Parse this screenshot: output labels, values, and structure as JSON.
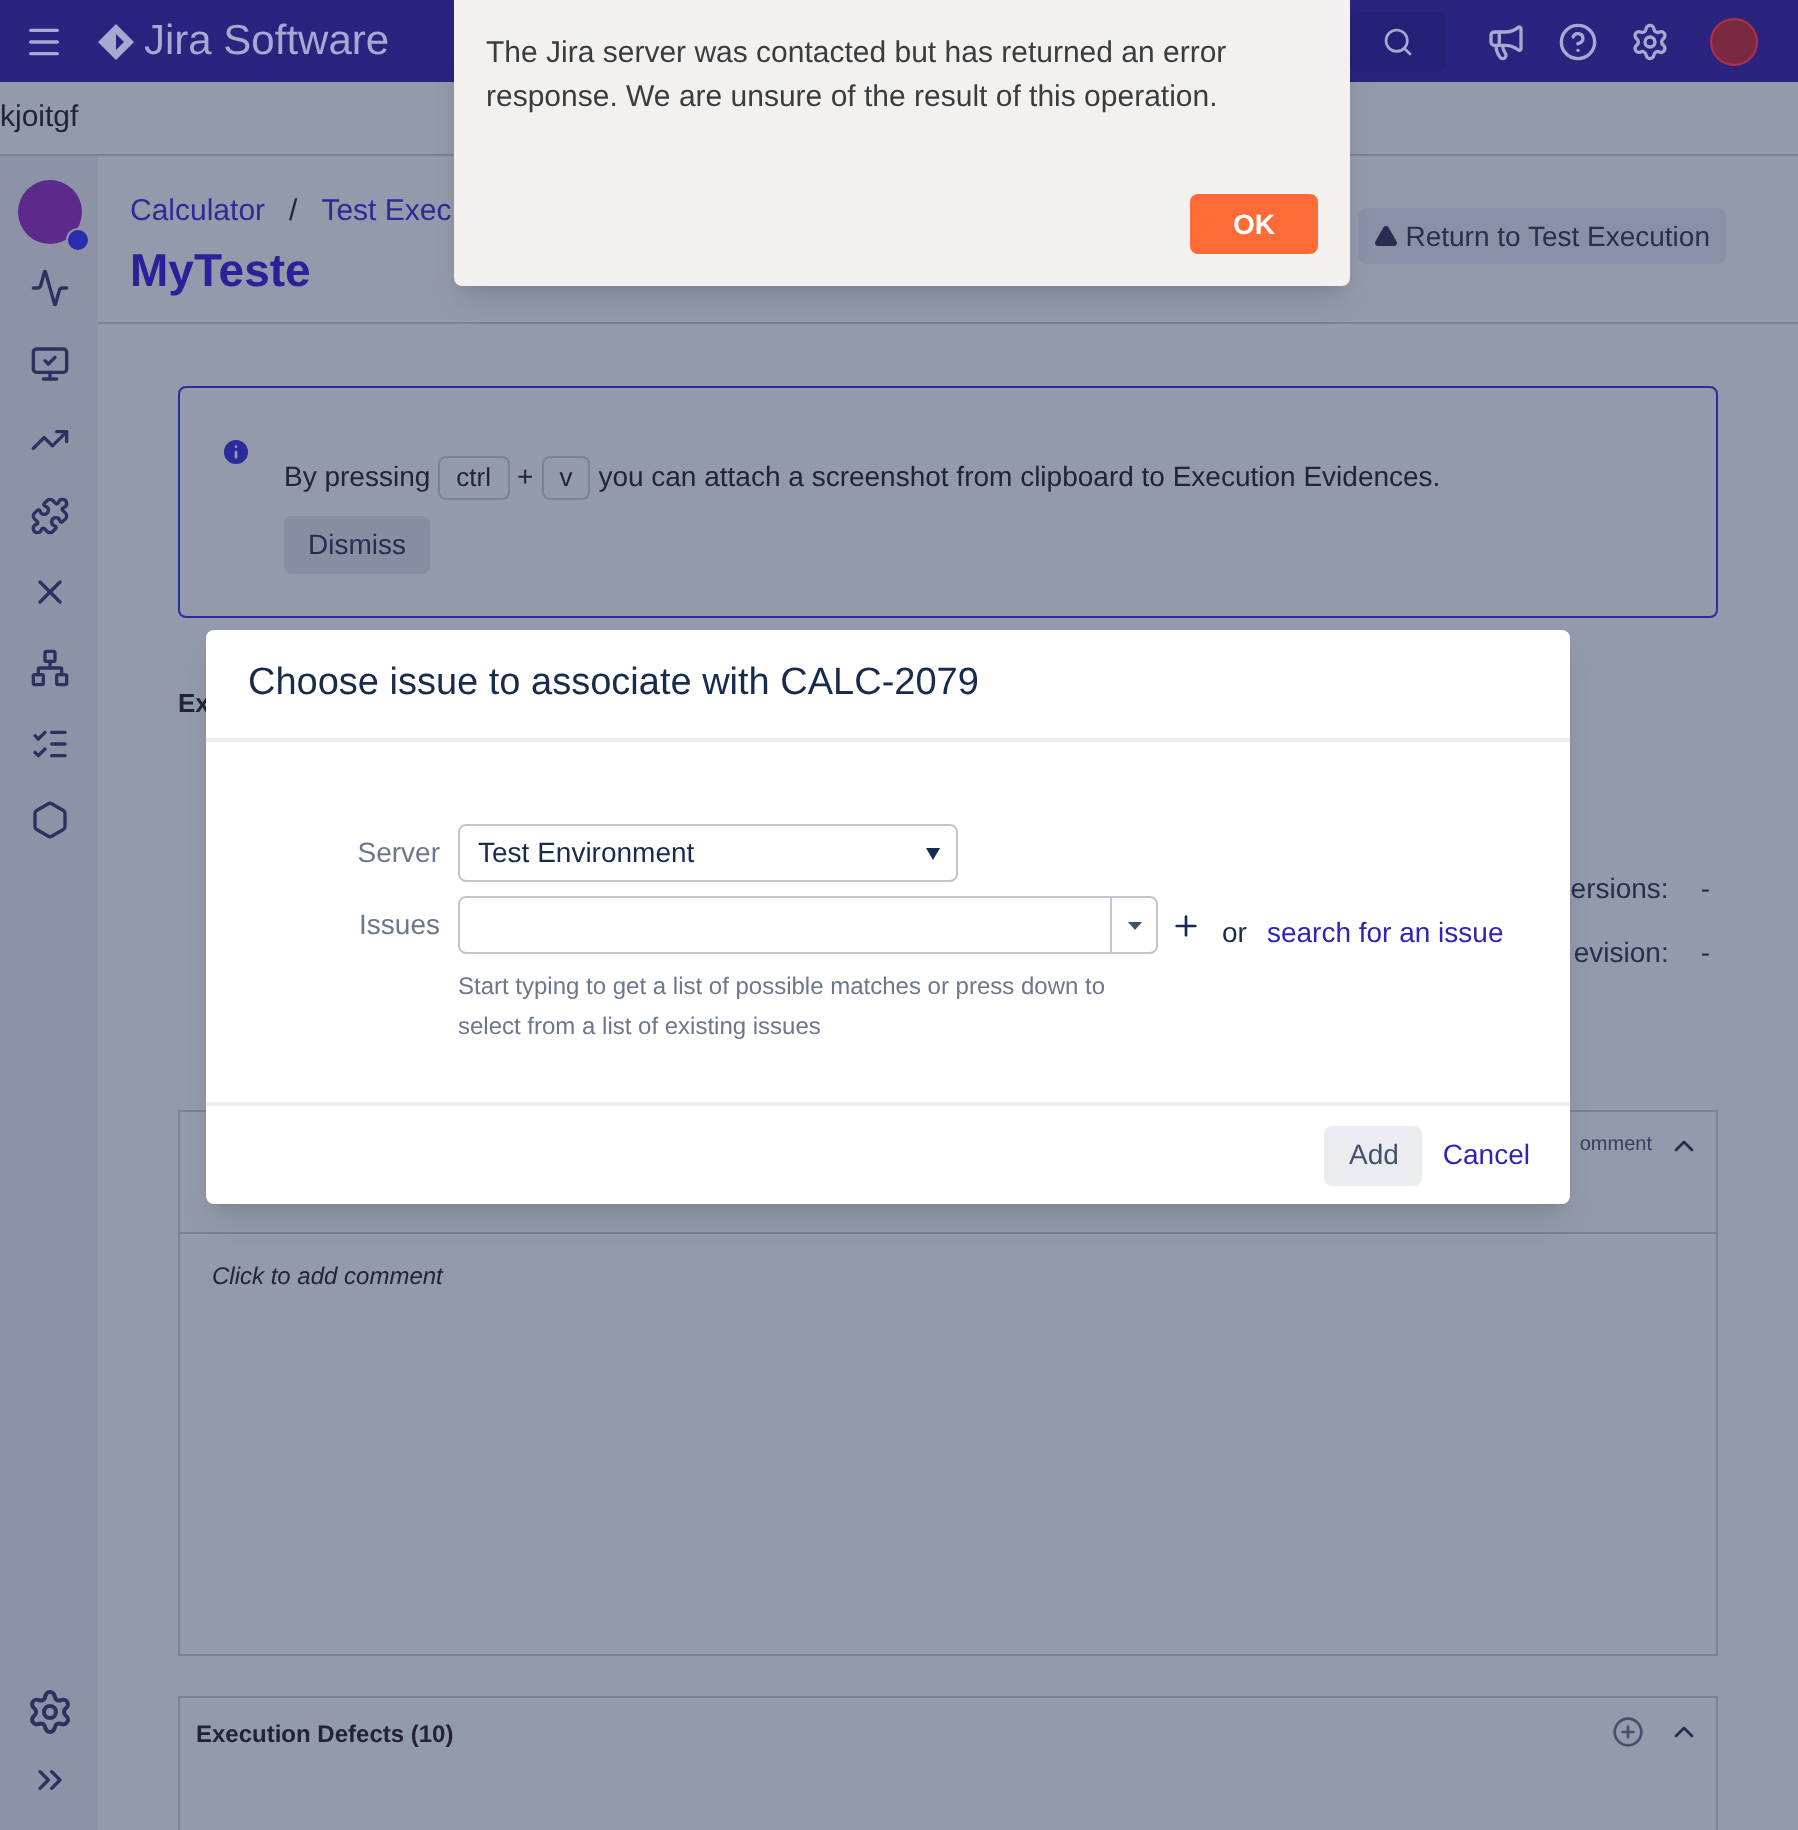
{
  "header": {
    "product": "Jira Software"
  },
  "project_bar": {
    "name": "kjoitgf"
  },
  "breadcrumb": {
    "items": [
      "Calculator",
      "Test Exec"
    ],
    "separator": "/"
  },
  "page_title": "MyTeste",
  "return_button": "Return to Test Execution",
  "info_banner": {
    "before": "By pressing",
    "keys": [
      "ctrl",
      "v"
    ],
    "joiner": "+",
    "after": "you can attach a screenshot from clipboard to Execution Evidences.",
    "dismiss": "Dismiss"
  },
  "section_heading": "Ex",
  "details": [
    {
      "label": "ersions:",
      "value": "-"
    },
    {
      "label": "evision:",
      "value": "-"
    }
  ],
  "comment_panel": {
    "action": "omment",
    "prompt": "Click to add comment"
  },
  "defects_panel": {
    "title": "Execution Defects (10)"
  },
  "associate_dialog": {
    "title": "Choose issue to associate with CALC-2079",
    "server_label": "Server",
    "server_value": "Test Environment",
    "issues_label": "Issues",
    "or": "or",
    "search_link": "search for an issue",
    "help": "Start typing to get a list of possible matches or press down to select from a list of existing issues",
    "add": "Add",
    "cancel": "Cancel"
  },
  "alert": {
    "message": "The Jira server was contacted but has returned an error response. We are unsure of the result of this operation.",
    "button": "OK"
  }
}
